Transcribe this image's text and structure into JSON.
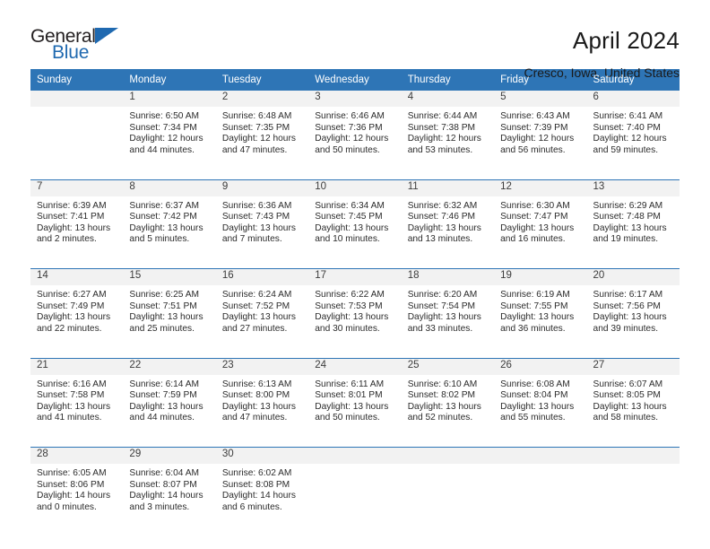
{
  "brand": {
    "name_top": "General",
    "name_bottom": "Blue",
    "logo_icon": "triangle-icon",
    "accent_color": "#1f69b0"
  },
  "header": {
    "title": "April 2024",
    "location": "Cresco, Iowa, United States"
  },
  "calendar": {
    "header_color": "#2e75b6",
    "daynum_band_color": "#f2f2f2",
    "weekday_headers": [
      "Sunday",
      "Monday",
      "Tuesday",
      "Wednesday",
      "Thursday",
      "Friday",
      "Saturday"
    ],
    "weeks": [
      [
        {
          "day": "",
          "sunrise": "",
          "sunset": "",
          "daylight_line1": "",
          "daylight_line2": ""
        },
        {
          "day": "1",
          "sunrise": "Sunrise: 6:50 AM",
          "sunset": "Sunset: 7:34 PM",
          "daylight_line1": "Daylight: 12 hours",
          "daylight_line2": "and 44 minutes."
        },
        {
          "day": "2",
          "sunrise": "Sunrise: 6:48 AM",
          "sunset": "Sunset: 7:35 PM",
          "daylight_line1": "Daylight: 12 hours",
          "daylight_line2": "and 47 minutes."
        },
        {
          "day": "3",
          "sunrise": "Sunrise: 6:46 AM",
          "sunset": "Sunset: 7:36 PM",
          "daylight_line1": "Daylight: 12 hours",
          "daylight_line2": "and 50 minutes."
        },
        {
          "day": "4",
          "sunrise": "Sunrise: 6:44 AM",
          "sunset": "Sunset: 7:38 PM",
          "daylight_line1": "Daylight: 12 hours",
          "daylight_line2": "and 53 minutes."
        },
        {
          "day": "5",
          "sunrise": "Sunrise: 6:43 AM",
          "sunset": "Sunset: 7:39 PM",
          "daylight_line1": "Daylight: 12 hours",
          "daylight_line2": "and 56 minutes."
        },
        {
          "day": "6",
          "sunrise": "Sunrise: 6:41 AM",
          "sunset": "Sunset: 7:40 PM",
          "daylight_line1": "Daylight: 12 hours",
          "daylight_line2": "and 59 minutes."
        }
      ],
      [
        {
          "day": "7",
          "sunrise": "Sunrise: 6:39 AM",
          "sunset": "Sunset: 7:41 PM",
          "daylight_line1": "Daylight: 13 hours",
          "daylight_line2": "and 2 minutes."
        },
        {
          "day": "8",
          "sunrise": "Sunrise: 6:37 AM",
          "sunset": "Sunset: 7:42 PM",
          "daylight_line1": "Daylight: 13 hours",
          "daylight_line2": "and 5 minutes."
        },
        {
          "day": "9",
          "sunrise": "Sunrise: 6:36 AM",
          "sunset": "Sunset: 7:43 PM",
          "daylight_line1": "Daylight: 13 hours",
          "daylight_line2": "and 7 minutes."
        },
        {
          "day": "10",
          "sunrise": "Sunrise: 6:34 AM",
          "sunset": "Sunset: 7:45 PM",
          "daylight_line1": "Daylight: 13 hours",
          "daylight_line2": "and 10 minutes."
        },
        {
          "day": "11",
          "sunrise": "Sunrise: 6:32 AM",
          "sunset": "Sunset: 7:46 PM",
          "daylight_line1": "Daylight: 13 hours",
          "daylight_line2": "and 13 minutes."
        },
        {
          "day": "12",
          "sunrise": "Sunrise: 6:30 AM",
          "sunset": "Sunset: 7:47 PM",
          "daylight_line1": "Daylight: 13 hours",
          "daylight_line2": "and 16 minutes."
        },
        {
          "day": "13",
          "sunrise": "Sunrise: 6:29 AM",
          "sunset": "Sunset: 7:48 PM",
          "daylight_line1": "Daylight: 13 hours",
          "daylight_line2": "and 19 minutes."
        }
      ],
      [
        {
          "day": "14",
          "sunrise": "Sunrise: 6:27 AM",
          "sunset": "Sunset: 7:49 PM",
          "daylight_line1": "Daylight: 13 hours",
          "daylight_line2": "and 22 minutes."
        },
        {
          "day": "15",
          "sunrise": "Sunrise: 6:25 AM",
          "sunset": "Sunset: 7:51 PM",
          "daylight_line1": "Daylight: 13 hours",
          "daylight_line2": "and 25 minutes."
        },
        {
          "day": "16",
          "sunrise": "Sunrise: 6:24 AM",
          "sunset": "Sunset: 7:52 PM",
          "daylight_line1": "Daylight: 13 hours",
          "daylight_line2": "and 27 minutes."
        },
        {
          "day": "17",
          "sunrise": "Sunrise: 6:22 AM",
          "sunset": "Sunset: 7:53 PM",
          "daylight_line1": "Daylight: 13 hours",
          "daylight_line2": "and 30 minutes."
        },
        {
          "day": "18",
          "sunrise": "Sunrise: 6:20 AM",
          "sunset": "Sunset: 7:54 PM",
          "daylight_line1": "Daylight: 13 hours",
          "daylight_line2": "and 33 minutes."
        },
        {
          "day": "19",
          "sunrise": "Sunrise: 6:19 AM",
          "sunset": "Sunset: 7:55 PM",
          "daylight_line1": "Daylight: 13 hours",
          "daylight_line2": "and 36 minutes."
        },
        {
          "day": "20",
          "sunrise": "Sunrise: 6:17 AM",
          "sunset": "Sunset: 7:56 PM",
          "daylight_line1": "Daylight: 13 hours",
          "daylight_line2": "and 39 minutes."
        }
      ],
      [
        {
          "day": "21",
          "sunrise": "Sunrise: 6:16 AM",
          "sunset": "Sunset: 7:58 PM",
          "daylight_line1": "Daylight: 13 hours",
          "daylight_line2": "and 41 minutes."
        },
        {
          "day": "22",
          "sunrise": "Sunrise: 6:14 AM",
          "sunset": "Sunset: 7:59 PM",
          "daylight_line1": "Daylight: 13 hours",
          "daylight_line2": "and 44 minutes."
        },
        {
          "day": "23",
          "sunrise": "Sunrise: 6:13 AM",
          "sunset": "Sunset: 8:00 PM",
          "daylight_line1": "Daylight: 13 hours",
          "daylight_line2": "and 47 minutes."
        },
        {
          "day": "24",
          "sunrise": "Sunrise: 6:11 AM",
          "sunset": "Sunset: 8:01 PM",
          "daylight_line1": "Daylight: 13 hours",
          "daylight_line2": "and 50 minutes."
        },
        {
          "day": "25",
          "sunrise": "Sunrise: 6:10 AM",
          "sunset": "Sunset: 8:02 PM",
          "daylight_line1": "Daylight: 13 hours",
          "daylight_line2": "and 52 minutes."
        },
        {
          "day": "26",
          "sunrise": "Sunrise: 6:08 AM",
          "sunset": "Sunset: 8:04 PM",
          "daylight_line1": "Daylight: 13 hours",
          "daylight_line2": "and 55 minutes."
        },
        {
          "day": "27",
          "sunrise": "Sunrise: 6:07 AM",
          "sunset": "Sunset: 8:05 PM",
          "daylight_line1": "Daylight: 13 hours",
          "daylight_line2": "and 58 minutes."
        }
      ],
      [
        {
          "day": "28",
          "sunrise": "Sunrise: 6:05 AM",
          "sunset": "Sunset: 8:06 PM",
          "daylight_line1": "Daylight: 14 hours",
          "daylight_line2": "and 0 minutes."
        },
        {
          "day": "29",
          "sunrise": "Sunrise: 6:04 AM",
          "sunset": "Sunset: 8:07 PM",
          "daylight_line1": "Daylight: 14 hours",
          "daylight_line2": "and 3 minutes."
        },
        {
          "day": "30",
          "sunrise": "Sunrise: 6:02 AM",
          "sunset": "Sunset: 8:08 PM",
          "daylight_line1": "Daylight: 14 hours",
          "daylight_line2": "and 6 minutes."
        },
        {
          "day": "",
          "sunrise": "",
          "sunset": "",
          "daylight_line1": "",
          "daylight_line2": ""
        },
        {
          "day": "",
          "sunrise": "",
          "sunset": "",
          "daylight_line1": "",
          "daylight_line2": ""
        },
        {
          "day": "",
          "sunrise": "",
          "sunset": "",
          "daylight_line1": "",
          "daylight_line2": ""
        },
        {
          "day": "",
          "sunrise": "",
          "sunset": "",
          "daylight_line1": "",
          "daylight_line2": ""
        }
      ]
    ]
  }
}
